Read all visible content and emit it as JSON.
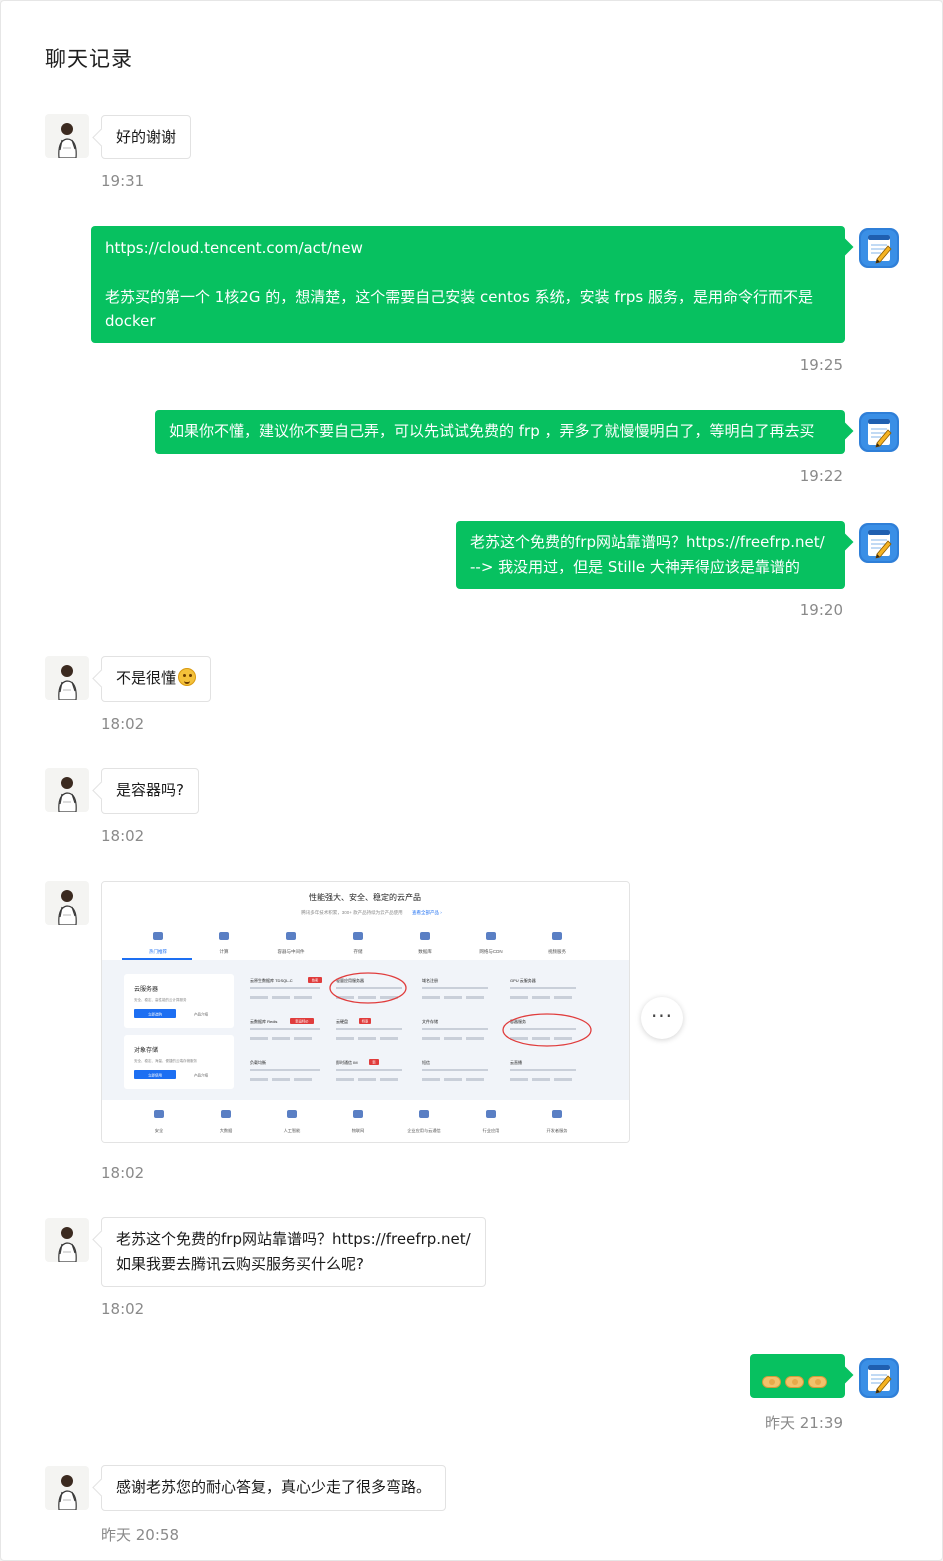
{
  "header": {
    "title": "聊天记录"
  },
  "messages": [
    {
      "side": "in",
      "text": "好的谢谢",
      "time": "19:31"
    },
    {
      "side": "out",
      "link": "https://cloud.tencent.com/act/new",
      "text": "老苏买的第一个 1核2G 的，想清楚，这个需要自己安装 centos 系统，安装 frps 服务，是用命令行而不是 docker",
      "time": "19:25"
    },
    {
      "side": "out",
      "text": "如果你不懂，建议你不要自己弄，可以先试试免费的 frp ，弄多了就慢慢明白了，等明白了再去买",
      "time": "19:22"
    },
    {
      "side": "out",
      "line1": "老苏这个免费的frp网站靠谱吗？https://freefrp.net/",
      "line2": "--> 我没用过，但是 Stille 大神弄得应该是靠谱的",
      "time": "19:20"
    },
    {
      "side": "in",
      "text": "不是很懂",
      "emoji": "smile-emoji",
      "time": "18:02"
    },
    {
      "side": "in",
      "text": "是容器吗?",
      "time": "18:02"
    },
    {
      "side": "in",
      "type": "image",
      "more_label": "···",
      "time": "18:02",
      "image": {
        "heading": "性能强大、安全、稳定的云产品",
        "subheading": "腾讯多年技术积累，300+ 款产品持续为云产品使用",
        "link": "查看全部产品 ›",
        "tabs": [
          "热门推荐",
          "计算",
          "容器与中间件",
          "存储",
          "数据库",
          "网络与CDN",
          "视频服务"
        ],
        "left_cards": [
          {
            "title": "云服务器",
            "desc": "安全、稳定、高性能的云计算服务",
            "primary": "立即选购",
            "secondary": "产品介绍"
          },
          {
            "title": "对象存储",
            "desc": "安全、稳定、海量、便捷的云端存储服务",
            "primary": "立即使用",
            "secondary": "产品介绍"
          }
        ],
        "products": [
          {
            "name": "云原生数据库 TDSQL-C",
            "tag": "热卖"
          },
          {
            "name": "轻量应用服务器",
            "tag": ""
          },
          {
            "name": "域名注册",
            "tag": ""
          },
          {
            "name": "GPU 云服务器",
            "tag": ""
          },
          {
            "name": "云数据库 Redis",
            "tag": "新品特价"
          },
          {
            "name": "云硬盘",
            "tag": "特惠"
          },
          {
            "name": "文件存储",
            "tag": ""
          },
          {
            "name": "容器服务",
            "tag": ""
          },
          {
            "name": "负载均衡",
            "tag": ""
          },
          {
            "name": "即时通信 IM",
            "tag": "新"
          },
          {
            "name": "短信",
            "tag": ""
          },
          {
            "name": "云直播",
            "tag": ""
          }
        ],
        "bottom_tabs": [
          "安全",
          "大数据",
          "人工智能",
          "物联网",
          "企业应用与云通信",
          "行业应用",
          "开发者服务"
        ]
      }
    },
    {
      "side": "in",
      "line1": "老苏这个免费的frp网站靠谱吗？https://freefrp.net/",
      "line2": "如果我要去腾讯云购买服务买什么呢?",
      "time": "18:02"
    },
    {
      "side": "out",
      "type": "emoji",
      "emoji": "handshake-emoji ×3",
      "time": "昨天 21:39"
    },
    {
      "side": "in",
      "text": "感谢老苏您的耐心答复，真心少走了很多弯路。",
      "time": "昨天 20:58"
    }
  ],
  "colors": {
    "outgoing_bubble": "#07c160",
    "incoming_bubble": "#ffffff",
    "time_text": "#8a8a8a"
  },
  "icons": {
    "contact_avatar": "person-avatar",
    "self_avatar": "notebook-pencil-avatar"
  }
}
